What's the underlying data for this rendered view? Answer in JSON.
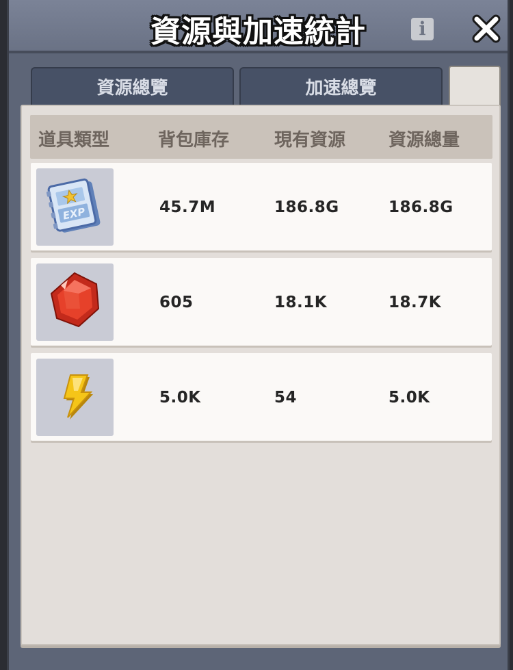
{
  "header": {
    "title": "資源與加速統計",
    "info_label": "i"
  },
  "tabs": [
    {
      "label": "資源總覽"
    },
    {
      "label": "加速總覽"
    }
  ],
  "table": {
    "columns": [
      "道具類型",
      "背包庫存",
      "現有資源",
      "資源總量"
    ],
    "rows": [
      {
        "icon": "exp-book-icon",
        "inventory": "45.7M",
        "current": "186.8G",
        "total": "186.8G"
      },
      {
        "icon": "red-gem-icon",
        "inventory": "605",
        "current": "18.1K",
        "total": "18.7K"
      },
      {
        "icon": "lightning-bolt-icon",
        "inventory": "5.0K",
        "current": "54",
        "total": "5.0K"
      }
    ]
  },
  "colors": {
    "frame": "#5d6577",
    "tab": "#475166",
    "panel": "#e3deda",
    "header_row": "#cac2ba",
    "row": "#fbf9f7"
  }
}
